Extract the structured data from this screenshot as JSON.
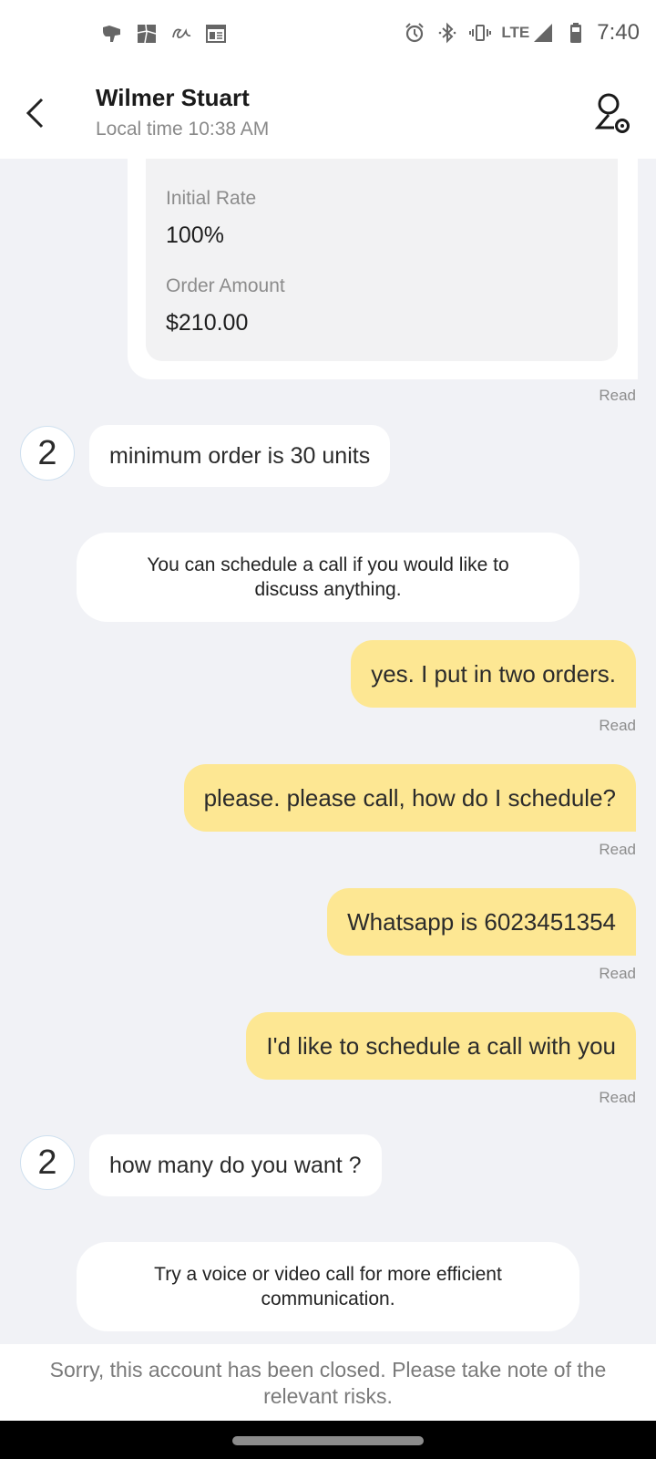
{
  "status_bar": {
    "left_icons": [
      "megaphone-icon",
      "patchwork-app-icon",
      "alibaba-app-icon",
      "news-calendar-icon"
    ],
    "right_icons": [
      "alarm-icon",
      "bluetooth-icon",
      "vibrate-icon"
    ],
    "network": "LTE",
    "time": "7:40"
  },
  "header": {
    "contact_name": "Wilmer Stuart",
    "local_time": "Local time 10:38 AM",
    "back_icon": "chevron-left-icon",
    "profile_icon": "user-settings-icon"
  },
  "order_card": {
    "fields": [
      {
        "label": "Initial Rate",
        "value": "100%"
      },
      {
        "label": "Order Amount",
        "value": "$210.00"
      }
    ],
    "status": "Read"
  },
  "messages": [
    {
      "type": "incoming",
      "avatar": "2",
      "text": "minimum order is 30 units"
    },
    {
      "type": "system",
      "text": "You can schedule a call if you would like to discuss anything."
    },
    {
      "type": "outgoing",
      "text": "yes. I put in two orders.",
      "status": "Read"
    },
    {
      "type": "outgoing",
      "text": "please. please call, how do I schedule?",
      "status": "Read"
    },
    {
      "type": "outgoing",
      "text": "Whatsapp is 6023451354",
      "status": "Read"
    },
    {
      "type": "outgoing",
      "text": "I'd like to schedule a call with you",
      "status": "Read"
    },
    {
      "type": "incoming",
      "avatar": "2",
      "text": "how many do you want ?"
    },
    {
      "type": "system",
      "text": "Try a voice or video call for more efficient communication."
    }
  ],
  "footer": {
    "notice": "Sorry, this account has been closed. Please take note of the relevant risks."
  },
  "colors": {
    "outgoing_bubble": "#fde793",
    "incoming_bubble": "#ffffff",
    "chat_background": "#f1f2f6"
  }
}
